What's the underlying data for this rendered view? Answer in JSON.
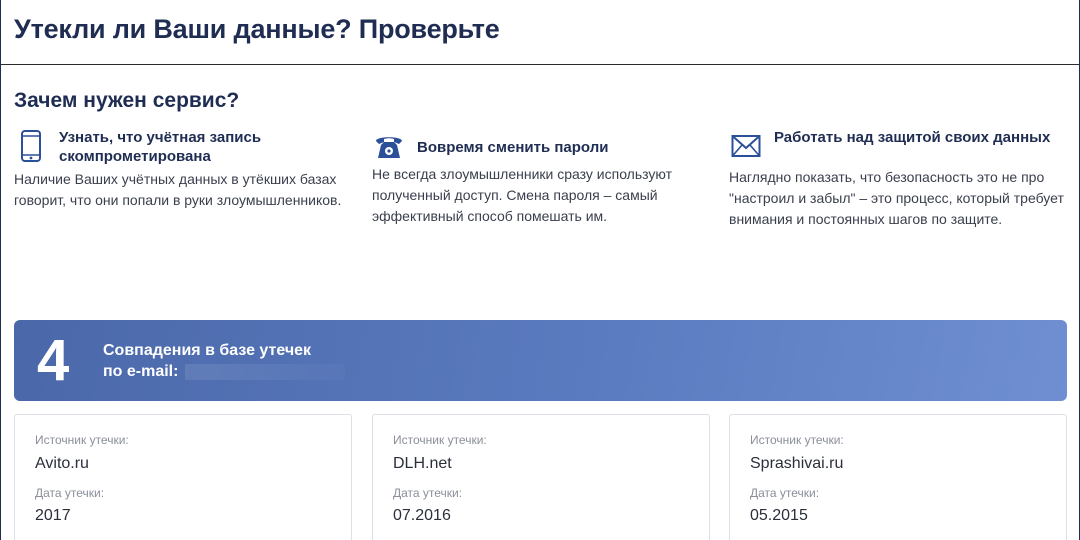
{
  "page": {
    "title": "Утекли ли Ваши данные? Проверьте",
    "section_title": "Зачем нужен сервис?"
  },
  "features": [
    {
      "icon": "smartphone-icon",
      "title": "Узнать, что учётная запись скомпрометирована",
      "description": "Наличие Ваших учётных данных в утёкших базах говорит, что они попали в руки злоумышленников."
    },
    {
      "icon": "telephone-icon",
      "title": "Вовремя сменить пароли",
      "description": "Не всегда злоумышленники сразу используют полученный доступ. Смена пароля – самый эффективный способ помешать им."
    },
    {
      "icon": "envelope-icon",
      "title": "Работать над защитой своих данных",
      "description": "Наглядно показать, что безопасность это не про \"настроил и забыл\" – это процесс, который требует внимания и постоянных шагов по защите."
    }
  ],
  "banner": {
    "count": "4",
    "title_line1": "Совпадения в базе утечек",
    "title_line2": "по e-mail:"
  },
  "leaks": {
    "source_label": "Источник утечки:",
    "date_label": "Дата утечки:",
    "items": [
      {
        "source": "Avito.ru",
        "date": "2017"
      },
      {
        "source": "DLH.net",
        "date": "07.2016"
      },
      {
        "source": "Sprashivai.ru",
        "date": "05.2015"
      }
    ]
  },
  "colors": {
    "primary_text": "#1f2d52",
    "icon": "#2c4f9a",
    "banner_start": "#4a68a9",
    "banner_end": "#6f8fd2"
  }
}
